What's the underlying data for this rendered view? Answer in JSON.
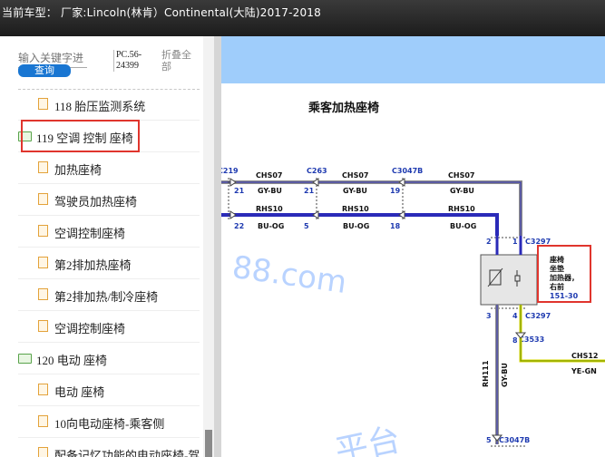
{
  "header": {
    "title": "当前车型： 厂家:Lincoln(林肯）Continental(大陆)2017-2018"
  },
  "search": {
    "placeholder": "输入关键字进",
    "button_label": "查询",
    "pc_code": "PC.56-24399",
    "collapse_label": "折叠全部"
  },
  "tree": [
    {
      "type": "file",
      "indent": 1,
      "label": "118 胎压监测系统"
    },
    {
      "type": "folder",
      "indent": 0,
      "label": "119 空调 控制 座椅"
    },
    {
      "type": "file",
      "indent": 1,
      "label": "加热座椅"
    },
    {
      "type": "file",
      "indent": 1,
      "label": "驾驶员加热座椅"
    },
    {
      "type": "file",
      "indent": 1,
      "label": "空调控制座椅"
    },
    {
      "type": "file",
      "indent": 1,
      "label": "第2排加热座椅"
    },
    {
      "type": "file",
      "indent": 1,
      "label": "第2排加热/制冷座椅"
    },
    {
      "type": "file",
      "indent": 1,
      "label": "空调控制座椅"
    },
    {
      "type": "folder",
      "indent": 0,
      "label": "120 电动 座椅"
    },
    {
      "type": "file",
      "indent": 1,
      "label": "电动 座椅"
    },
    {
      "type": "file",
      "indent": 1,
      "label": "10向电动座椅-乘客侧"
    },
    {
      "type": "file",
      "indent": 1,
      "label": "配备记忆功能的电动座椅-驾"
    }
  ],
  "diagram": {
    "title": "乘客加热座椅",
    "connectors": [
      "C219",
      "C263",
      "C3047B",
      "C3297",
      "C3297",
      "C3533",
      "C3047B"
    ],
    "circuits_top": [
      "CHS07",
      "CHS07",
      "CHS07"
    ],
    "colors_top": [
      "GY-BU",
      "GY-BU",
      "GY-BU"
    ],
    "pins_top": [
      "21",
      "21",
      "19"
    ],
    "circuits_bot": [
      "RHS10",
      "RHS10",
      "RHS10"
    ],
    "colors_bot": [
      "BU-OG",
      "BU-OG",
      "BU-OG"
    ],
    "pins_bot": [
      "22",
      "5",
      "18"
    ],
    "module_pins": [
      "2",
      "1",
      "3",
      "4"
    ],
    "module_label": [
      "座椅",
      "坐垫",
      "加热器，",
      "右前"
    ],
    "module_ref": "151-30",
    "vert_circuit": "RH111",
    "vert_color": "GY-BU",
    "pin8": "8",
    "pin5": "5",
    "right_circuit": "CHS12",
    "right_color": "YE-GN",
    "watermark_1": "88.com",
    "watermark_2": "平台",
    "accent_wire_blue": "#2a2ab8",
    "accent_wire_gray": "#8c8c8c",
    "accent_wire_yellow": "#d8d800",
    "label_blue": "#1e3ab0"
  }
}
